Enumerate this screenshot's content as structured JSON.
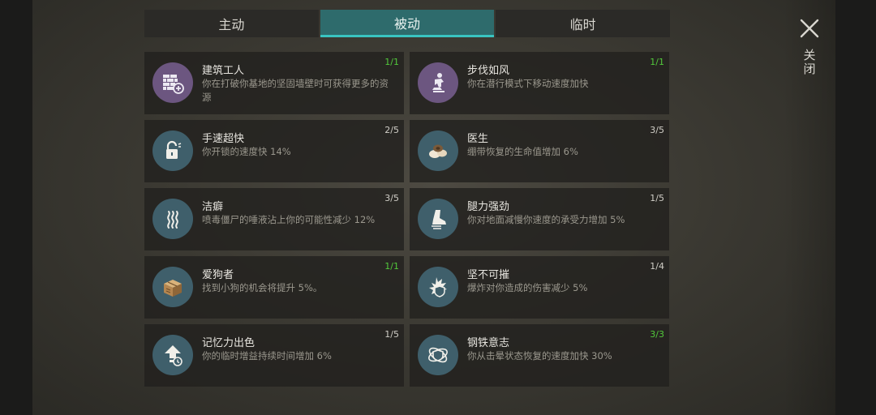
{
  "tabs": [
    {
      "label": "主动",
      "active": false
    },
    {
      "label": "被动",
      "active": true
    },
    {
      "label": "临时",
      "active": false
    }
  ],
  "close": {
    "label": "关闭",
    "icon": "close-icon"
  },
  "colors": {
    "active_tab": "#2e6b6c",
    "tab_underline": "#39c4c1",
    "max_level": "#52c93b",
    "purple_icon_bg": "#6c5680",
    "teal_icon_bg": "#3f5f6b"
  },
  "skills": [
    {
      "title": "建筑工人",
      "desc": "你在打破你基地的坚固墙壁时可获得更多的资源",
      "level": "1/1",
      "max": true,
      "icon": "brick-wall-icon",
      "icon_style": "purple"
    },
    {
      "title": "步伐如风",
      "desc": "你在潜行模式下移动速度加快",
      "level": "1/1",
      "max": true,
      "icon": "sneaking-figure-icon",
      "icon_style": "purple"
    },
    {
      "title": "手速超快",
      "desc": "你开锁的速度快 14%",
      "level": "2/5",
      "max": false,
      "icon": "unlocked-padlock-icon",
      "icon_style": "teal"
    },
    {
      "title": "医生",
      "desc": "绷带恢复的生命值增加 6%",
      "level": "3/5",
      "max": false,
      "icon": "bandage-rolls-icon",
      "icon_style": "teal"
    },
    {
      "title": "洁癖",
      "desc": "喷毒僵尸的唾液沾上你的可能性减少 12%",
      "level": "3/5",
      "max": false,
      "icon": "fumes-icon",
      "icon_style": "teal"
    },
    {
      "title": "腿力强劲",
      "desc": "你对地面减慢你速度的承受力增加 5%",
      "level": "1/5",
      "max": false,
      "icon": "boot-icon",
      "icon_style": "teal"
    },
    {
      "title": "爱狗者",
      "desc": "找到小狗的机会将提升 5%。",
      "level": "1/1",
      "max": true,
      "icon": "crate-icon",
      "icon_style": "teal"
    },
    {
      "title": "坚不可摧",
      "desc": "爆炸对你造成的伤害减少 5%",
      "level": "1/4",
      "max": false,
      "icon": "explosion-shield-icon",
      "icon_style": "teal"
    },
    {
      "title": "记忆力出色",
      "desc": "你的临时增益持续时间增加 6%",
      "level": "1/5",
      "max": false,
      "icon": "boost-clock-icon",
      "icon_style": "teal"
    },
    {
      "title": "钢铁意志",
      "desc": "你从击晕状态恢复的速度加快 30%",
      "level": "3/3",
      "max": true,
      "icon": "orbit-shield-icon",
      "icon_style": "teal"
    }
  ]
}
